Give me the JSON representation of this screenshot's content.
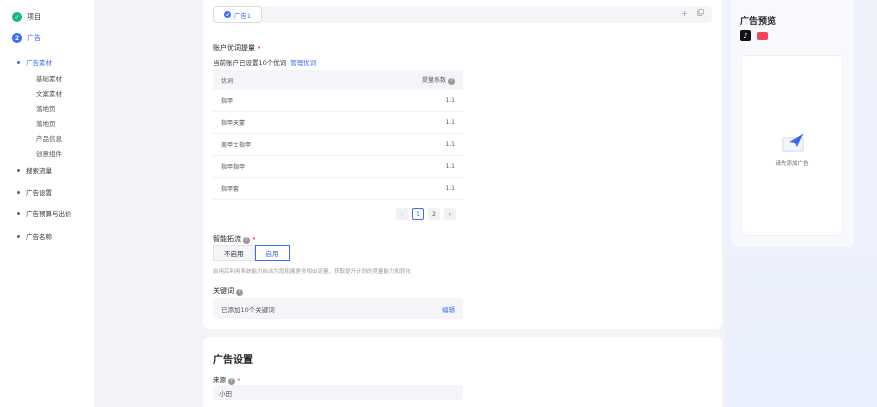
{
  "sidebar": {
    "steps": [
      {
        "label": "项目",
        "state": "done"
      },
      {
        "label": "广告",
        "state": "active",
        "number": "2"
      }
    ],
    "items": [
      {
        "label": "广告素材",
        "active": true,
        "children": [
          "基础素材",
          "文案素材",
          "落地页",
          "落地页",
          "产品信息",
          "创意组件"
        ]
      },
      {
        "label": "搜索流量"
      },
      {
        "label": "广告设置"
      },
      {
        "label": "广告预算与出价"
      },
      {
        "label": "广告名称"
      }
    ]
  },
  "tabs": {
    "active_label": "广告1",
    "add_icon": "plus-icon",
    "copy_icon": "copy-icon"
  },
  "keywords": {
    "section_title": "账户优词提量",
    "hint": "当前账户已设置10个优词",
    "manage_link": "管理优词",
    "table": {
      "headers": {
        "word": "优词",
        "factor": "提量系数"
      },
      "rows": [
        {
          "word": "指甲",
          "factor": "1.1"
        },
        {
          "word": "指甲天蒙",
          "factor": "1.1"
        },
        {
          "word": "美甲士指甲",
          "factor": "1.1"
        },
        {
          "word": "指甲指甲",
          "factor": "1.1"
        },
        {
          "word": "指甲套",
          "factor": "1.1"
        }
      ]
    },
    "pagination": {
      "prev": "‹",
      "pages": [
        "1",
        "2"
      ],
      "current": "1",
      "next": "›"
    }
  },
  "smart_expand": {
    "label": "智能拓流",
    "options": [
      "不启用",
      "启用"
    ],
    "selected": "启用",
    "description": "启用后利用系统能力自动为您拓展更多相似流量，获取提升计划的竞量能力和转化"
  },
  "keyword_box": {
    "label": "关键词",
    "value": "已添加10个关键词",
    "edit": "编辑"
  },
  "ad_settings": {
    "title": "广告设置",
    "source_label": "来源",
    "source_value": "小田"
  },
  "preview": {
    "title": "广告预览",
    "empty_text": "请先添加广告",
    "colors": {
      "tiktok": "#111111",
      "brand": "#f5455a"
    }
  },
  "colors": {
    "accent": "#3b6ef6",
    "success": "#16b979",
    "required": "#f5455a"
  }
}
